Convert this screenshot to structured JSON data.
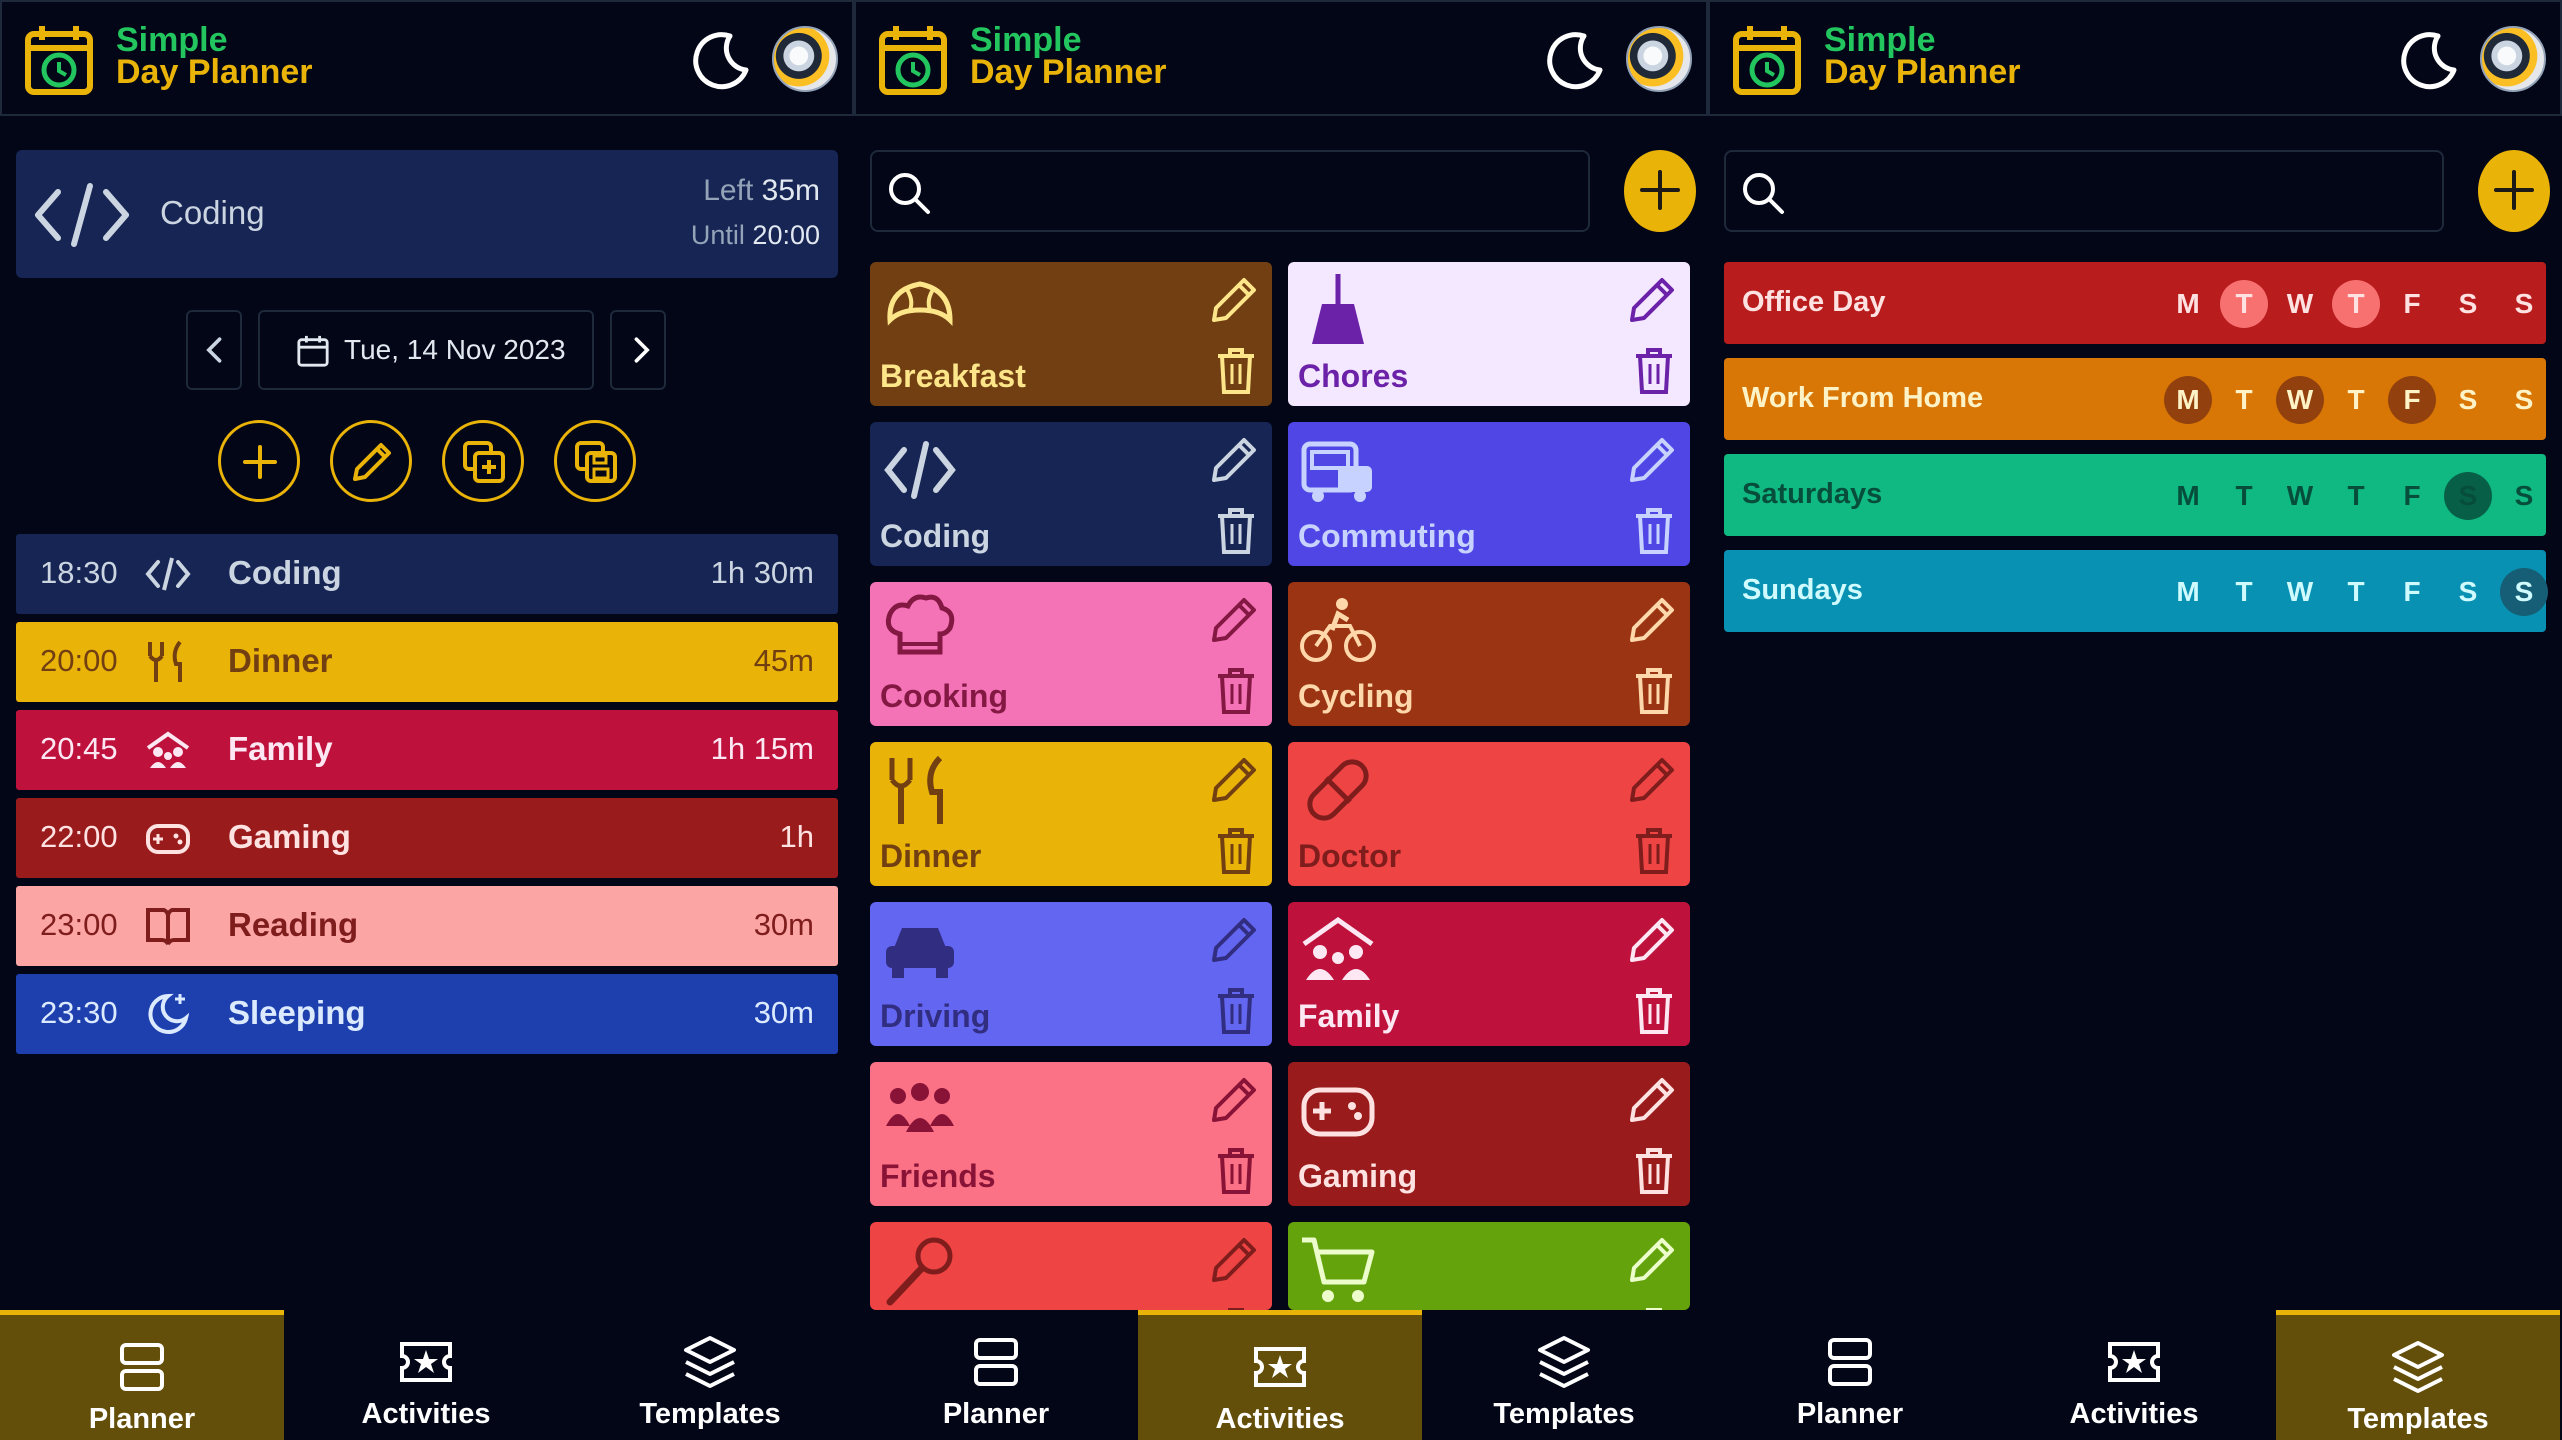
{
  "app": {
    "name_line1": "Simple",
    "name_line2": "Day Planner"
  },
  "nav": {
    "planner": "Planner",
    "activities": "Activities",
    "templates": "Templates"
  },
  "planner": {
    "current": {
      "name": "Coding",
      "left_label": "Left",
      "left_value": "35m",
      "until_label": "Until",
      "until_value": "20:00"
    },
    "date": "Tue, 14 Nov 2023",
    "schedule": [
      {
        "time": "18:30",
        "name": "Coding",
        "duration": "1h 30m",
        "icon": "code-icon",
        "bg": "#172554",
        "fg": "#cbd5e1"
      },
      {
        "time": "20:00",
        "name": "Dinner",
        "duration": "45m",
        "icon": "fork-knife-icon",
        "bg": "#eab308",
        "fg": "#713f12"
      },
      {
        "time": "20:45",
        "name": "Family",
        "duration": "1h 15m",
        "icon": "family-icon",
        "bg": "#be123c",
        "fg": "#fce7f3"
      },
      {
        "time": "22:00",
        "name": "Gaming",
        "duration": "1h",
        "icon": "gamepad-icon",
        "bg": "#991b1b",
        "fg": "#fee2e2"
      },
      {
        "time": "23:00",
        "name": "Reading",
        "duration": "30m",
        "icon": "book-icon",
        "bg": "#fca5a5",
        "fg": "#7f1d1d"
      },
      {
        "time": "23:30",
        "name": "Sleeping",
        "duration": "30m",
        "icon": "moon-icon",
        "bg": "#1e40af",
        "fg": "#dbeafe"
      }
    ]
  },
  "activities": {
    "search_placeholder": "",
    "items": [
      {
        "name": "Breakfast",
        "icon": "croissant-icon",
        "bg": "#713f12",
        "fg": "#fde68a"
      },
      {
        "name": "Chores",
        "icon": "broom-icon",
        "bg": "#f3e8ff",
        "fg": "#6b21a8"
      },
      {
        "name": "Coding",
        "icon": "code-icon",
        "bg": "#172554",
        "fg": "#cbd5e1"
      },
      {
        "name": "Commuting",
        "icon": "bus-icon",
        "bg": "#4f46e5",
        "fg": "#c7d2fe"
      },
      {
        "name": "Cooking",
        "icon": "chef-hat-icon",
        "bg": "#f472b6",
        "fg": "#831843"
      },
      {
        "name": "Cycling",
        "icon": "bicycle-icon",
        "bg": "#9a3412",
        "fg": "#fed7aa"
      },
      {
        "name": "Dinner",
        "icon": "fork-knife-icon",
        "bg": "#eab308",
        "fg": "#713f12"
      },
      {
        "name": "Doctor",
        "icon": "pill-icon",
        "bg": "#ef4444",
        "fg": "#7f1d1d"
      },
      {
        "name": "Driving",
        "icon": "car-icon",
        "bg": "#6366f1",
        "fg": "#312e81"
      },
      {
        "name": "Family",
        "icon": "family-icon",
        "bg": "#be123c",
        "fg": "#fce7f3"
      },
      {
        "name": "Friends",
        "icon": "friends-icon",
        "bg": "#fb7185",
        "fg": "#881337"
      },
      {
        "name": "Gaming",
        "icon": "gamepad-icon",
        "bg": "#991b1b",
        "fg": "#fee2e2"
      },
      {
        "name": "",
        "icon": "microphone-icon",
        "bg": "#ef4444",
        "fg": "#7f1d1d"
      },
      {
        "name": "",
        "icon": "cart-icon",
        "bg": "#65a30d",
        "fg": "#ecfccb"
      }
    ]
  },
  "templates": {
    "search_placeholder": "",
    "days": [
      "M",
      "T",
      "W",
      "T",
      "F",
      "S",
      "S"
    ],
    "items": [
      {
        "name": "Office Day",
        "bg": "#b91c1c",
        "fg": "#fee2e2",
        "active_bg": "#f87171",
        "active": [
          false,
          true,
          false,
          true,
          false,
          false,
          false
        ]
      },
      {
        "name": "Work From Home",
        "bg": "#d97706",
        "fg": "#fef3c7",
        "active_bg": "#92400e",
        "active": [
          true,
          false,
          true,
          false,
          true,
          false,
          false
        ]
      },
      {
        "name": "Saturdays",
        "bg": "#10b981",
        "fg": "#064e3b",
        "active_bg": "#065f46",
        "active": [
          false,
          false,
          false,
          false,
          false,
          true,
          false
        ]
      },
      {
        "name": "Sundays",
        "bg": "#0891b2",
        "fg": "#cffafe",
        "active_bg": "#155e75",
        "active": [
          false,
          false,
          false,
          false,
          false,
          false,
          true
        ]
      }
    ]
  },
  "colors": {
    "accent": "#eab308",
    "brand_green": "#22c55e",
    "background": "#020617",
    "nav_active": "#634f0a"
  }
}
